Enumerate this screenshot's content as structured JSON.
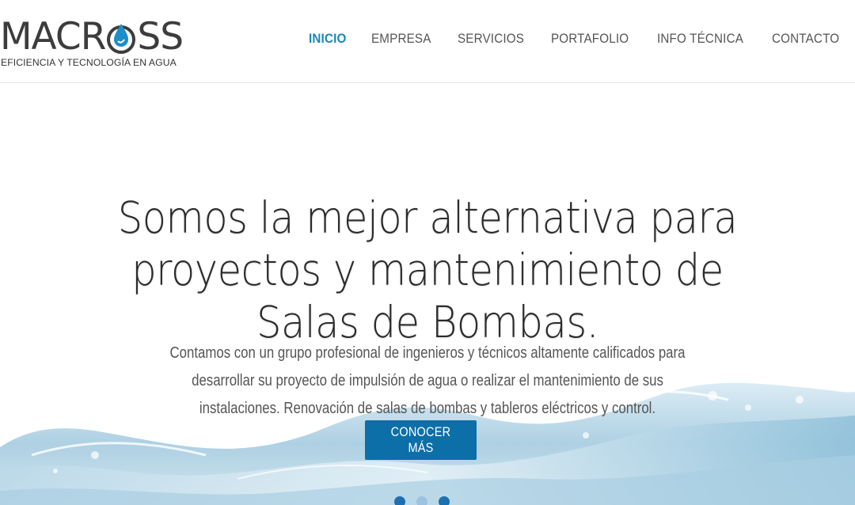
{
  "brand": {
    "name_part1": "MACR",
    "name_part2": "SS",
    "tagline": "EFICIENCIA Y TECNOLOGÍA EN AGUA"
  },
  "nav": {
    "items": [
      {
        "label": "INICIO",
        "active": true
      },
      {
        "label": "EMPRESA",
        "active": false
      },
      {
        "label": "SERVICIOS",
        "active": false
      },
      {
        "label": "PORTAFOLIO",
        "active": false
      },
      {
        "label": "INFO TÉCNICA",
        "active": false
      },
      {
        "label": "CONTACTO",
        "active": false
      }
    ]
  },
  "hero": {
    "headline_lines": [
      "Somos la mejor alternativa para",
      "proyectos y mantenimiento de",
      "Salas de Bombas."
    ],
    "description": "Contamos con un grupo profesional de ingenieros y técnicos altamente calificados para desarrollar su proyecto de impulsión de agua o realizar el mantenimiento de sus instalaciones. Renovación de salas de bombas y tableros eléctricos y control.",
    "cta_label": "CONOCER MÁS"
  },
  "colors": {
    "accent": "#1a88b8",
    "button": "#0d6fa8",
    "text": "#2b2b2b"
  },
  "icons": {
    "logo_drop": "water-drop-icon"
  }
}
